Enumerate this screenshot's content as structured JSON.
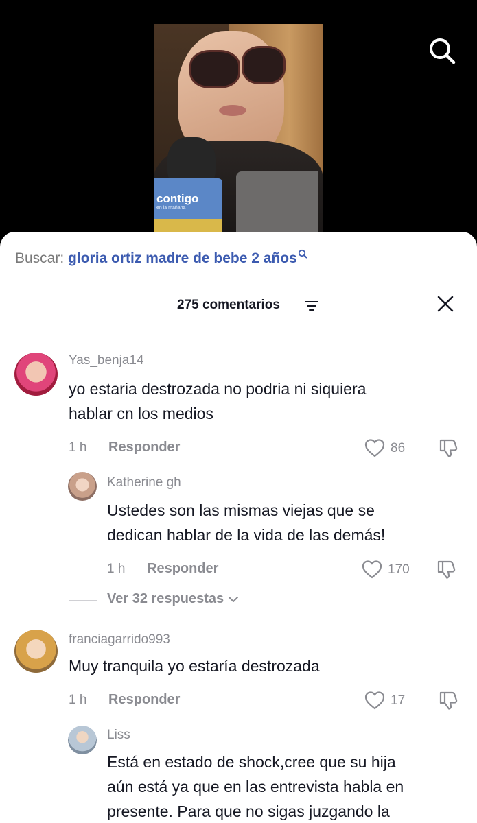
{
  "video": {
    "mic_brand": "contigo",
    "mic_subtitle": "en la mañana"
  },
  "search": {
    "prefix": "Buscar:",
    "query": "gloria ortiz madre de bebe 2 años"
  },
  "comments_header": {
    "count_label": "275 comentarios"
  },
  "colors": {
    "query_blue": "#3c5bb0",
    "secondary_text": "#8a8b91",
    "primary_text": "#161823"
  },
  "comments": [
    {
      "username": "Yas_benja14",
      "lines": [
        "yo estaria destrozada no podria ni siquiera",
        "hablar cn los medios"
      ],
      "time": "1 h",
      "reply_label": "Responder",
      "likes": "86",
      "replies": [
        {
          "username": "Katherine gh",
          "lines": [
            "Ustedes son las mismas viejas que se",
            "dedican hablar de la vida de las demás!"
          ],
          "time": "1 h",
          "reply_label": "Responder",
          "likes": "170"
        }
      ],
      "view_replies_label": "Ver 32 respuestas"
    },
    {
      "username": "franciagarrido993",
      "lines": [
        "Muy tranquila yo estaría destrozada"
      ],
      "time": "1 h",
      "reply_label": "Responder",
      "likes": "17",
      "replies": [
        {
          "username": "Liss",
          "lines": [
            "Está en estado de shock,cree que su hija",
            "aún está ya que en las entrevista habla en",
            "presente. Para que no sigas juzgando la"
          ]
        }
      ]
    }
  ]
}
